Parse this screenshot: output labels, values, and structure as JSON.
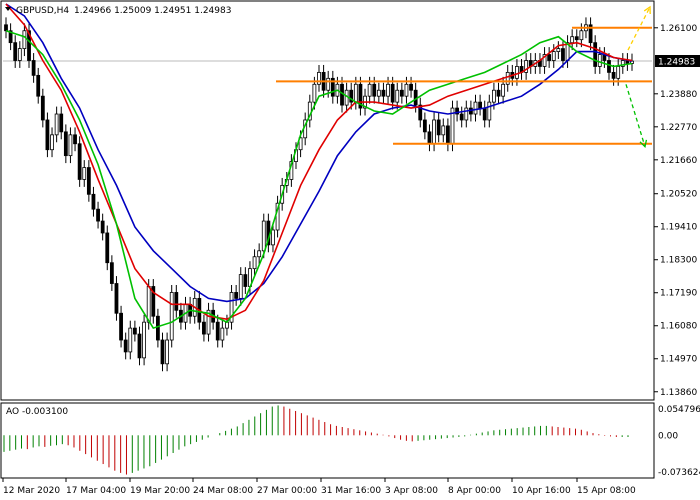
{
  "header": {
    "symbol": "GBPUSD,H4",
    "ohlc": "1.24966 1.25009 1.24951 1.24983"
  },
  "colors": {
    "background": "#ffffff",
    "frame": "#000000",
    "candle": "#000000",
    "ma_fast": "#00c000",
    "ma_mid": "#e00000",
    "ma_slow": "#0000c0",
    "level": "#ff7f00",
    "arrow_up": "#ffd000",
    "arrow_down": "#00c000",
    "ao_up": "#008000",
    "ao_down": "#c00000",
    "price_box": "#000000",
    "price_text": "#ffffff"
  },
  "chart_data": {
    "type": "candlestick",
    "y_ticks": [
      "1.26100",
      "1.24983",
      "1.23880",
      "1.22770",
      "1.21660",
      "1.20520",
      "1.19410",
      "1.18300",
      "1.17190",
      "1.16080",
      "1.14970",
      "1.13860"
    ],
    "ylim": [
      1.1365,
      1.269
    ],
    "current_price": 1.24983,
    "current_price_label": "1.24983",
    "x_labels": [
      "12 Mar 2020",
      "17 Mar 04:00",
      "19 Mar 20:00",
      "24 Mar 08:00",
      "27 Mar 00:00",
      "31 Mar 16:00",
      "3 Apr 08:00",
      "8 Apr 00:00",
      "10 Apr 16:00",
      "15 Apr 08:00"
    ],
    "levels": [
      1.261,
      1.243,
      1.222
    ],
    "arrows": [
      {
        "direction": "up",
        "from": 1.2535,
        "to": 1.268
      },
      {
        "direction": "down",
        "from": 1.242,
        "to": 1.221
      }
    ],
    "closes": [
      1.26,
      1.256,
      1.25,
      1.254,
      1.26,
      1.25,
      1.245,
      1.238,
      1.23,
      1.22,
      1.225,
      1.232,
      1.226,
      1.218,
      1.225,
      1.222,
      1.21,
      1.214,
      1.205,
      1.2,
      1.196,
      1.192,
      1.182,
      1.175,
      1.165,
      1.156,
      1.152,
      1.16,
      1.158,
      1.15,
      1.162,
      1.174,
      1.164,
      1.156,
      1.148,
      1.156,
      1.172,
      1.166,
      1.162,
      1.168,
      1.164,
      1.17,
      1.162,
      1.158,
      1.166,
      1.162,
      1.156,
      1.16,
      1.162,
      1.172,
      1.17,
      1.178,
      1.174,
      1.18,
      1.184,
      1.186,
      1.196,
      1.188,
      1.193,
      1.202,
      1.208,
      1.21,
      1.216,
      1.22,
      1.224,
      1.23,
      1.236,
      1.242,
      1.246,
      1.24,
      1.244,
      1.238,
      1.242,
      1.235,
      1.24,
      1.236,
      1.242,
      1.234,
      1.238,
      1.242,
      1.238,
      1.24,
      1.238,
      1.242,
      1.236,
      1.24,
      1.238,
      1.242,
      1.24,
      1.235,
      1.23,
      1.226,
      1.222,
      1.23,
      1.225,
      1.228,
      1.222,
      1.234,
      1.232,
      1.23,
      1.234,
      1.232,
      1.236,
      1.234,
      1.23,
      1.236,
      1.24,
      1.238,
      1.242,
      1.246,
      1.244,
      1.248,
      1.246,
      1.25,
      1.248,
      1.25,
      1.248,
      1.252,
      1.25,
      1.253,
      1.254,
      1.25,
      1.256,
      1.258,
      1.257,
      1.26,
      1.262,
      1.256,
      1.248,
      1.252,
      1.25,
      1.246,
      1.244,
      1.248,
      1.25,
      1.249,
      1.2498
    ],
    "ma_fast_values": [
      1.26,
      1.258,
      1.252,
      1.242,
      1.23,
      1.215,
      1.195,
      1.17,
      1.16,
      1.162,
      1.166,
      1.165,
      1.162,
      1.17,
      1.185,
      1.205,
      1.225,
      1.238,
      1.24,
      1.236,
      1.233,
      1.232,
      1.236,
      1.24,
      1.242,
      1.244,
      1.246,
      1.249,
      1.252,
      1.256,
      1.258,
      1.253,
      1.25,
      1.248,
      1.249
    ],
    "ma_mid_values": [
      1.269,
      1.262,
      1.25,
      1.24,
      1.226,
      1.21,
      1.195,
      1.18,
      1.172,
      1.168,
      1.168,
      1.164,
      1.163,
      1.166,
      1.176,
      1.192,
      1.208,
      1.22,
      1.23,
      1.236,
      1.236,
      1.235,
      1.234,
      1.235,
      1.238,
      1.24,
      1.242,
      1.244,
      1.246,
      1.25,
      1.255,
      1.256,
      1.254,
      1.251,
      1.25
    ],
    "ma_slow_values": [
      1.269,
      1.265,
      1.256,
      1.244,
      1.234,
      1.22,
      1.208,
      1.194,
      1.186,
      1.18,
      1.174,
      1.17,
      1.169,
      1.17,
      1.175,
      1.184,
      1.195,
      1.206,
      1.218,
      1.226,
      1.232,
      1.234,
      1.235,
      1.233,
      1.232,
      1.233,
      1.234,
      1.236,
      1.238,
      1.242,
      1.247,
      1.253,
      1.253,
      1.251,
      1.2498
    ],
    "ao": {
      "label": "AO -0.003100",
      "y_ticks": [
        "0.054796",
        "0.00",
        "-0.073624"
      ],
      "ylim": [
        -0.073624,
        0.054796
      ],
      "values": [
        -0.03,
        -0.028,
        -0.026,
        -0.024,
        -0.025,
        -0.022,
        -0.02,
        -0.021,
        -0.019,
        -0.018,
        -0.016,
        -0.018,
        -0.022,
        -0.028,
        -0.034,
        -0.04,
        -0.046,
        -0.052,
        -0.058,
        -0.064,
        -0.068,
        -0.071,
        -0.068,
        -0.064,
        -0.06,
        -0.056,
        -0.05,
        -0.044,
        -0.038,
        -0.032,
        -0.026,
        -0.02,
        -0.016,
        -0.012,
        -0.008,
        -0.004,
        0.0,
        0.004,
        0.008,
        0.012,
        0.016,
        0.022,
        0.028,
        0.034,
        0.04,
        0.046,
        0.052,
        0.054,
        0.052,
        0.048,
        0.044,
        0.04,
        0.036,
        0.032,
        0.028,
        0.024,
        0.02,
        0.017,
        0.015,
        0.013,
        0.011,
        0.009,
        0.007,
        0.005,
        0.003,
        0.001,
        -0.002,
        -0.005,
        -0.008,
        -0.01,
        -0.011,
        -0.01,
        -0.009,
        -0.008,
        -0.007,
        -0.006,
        -0.005,
        -0.004,
        -0.003,
        -0.002,
        0.001,
        0.003,
        0.005,
        0.007,
        0.009,
        0.01,
        0.011,
        0.012,
        0.013,
        0.014,
        0.015,
        0.016,
        0.017,
        0.017,
        0.016,
        0.015,
        0.014,
        0.013,
        0.012,
        0.01,
        0.007,
        0.004,
        0.002,
        -0.001,
        -0.002,
        -0.003,
        -0.003,
        -0.003
      ]
    }
  }
}
